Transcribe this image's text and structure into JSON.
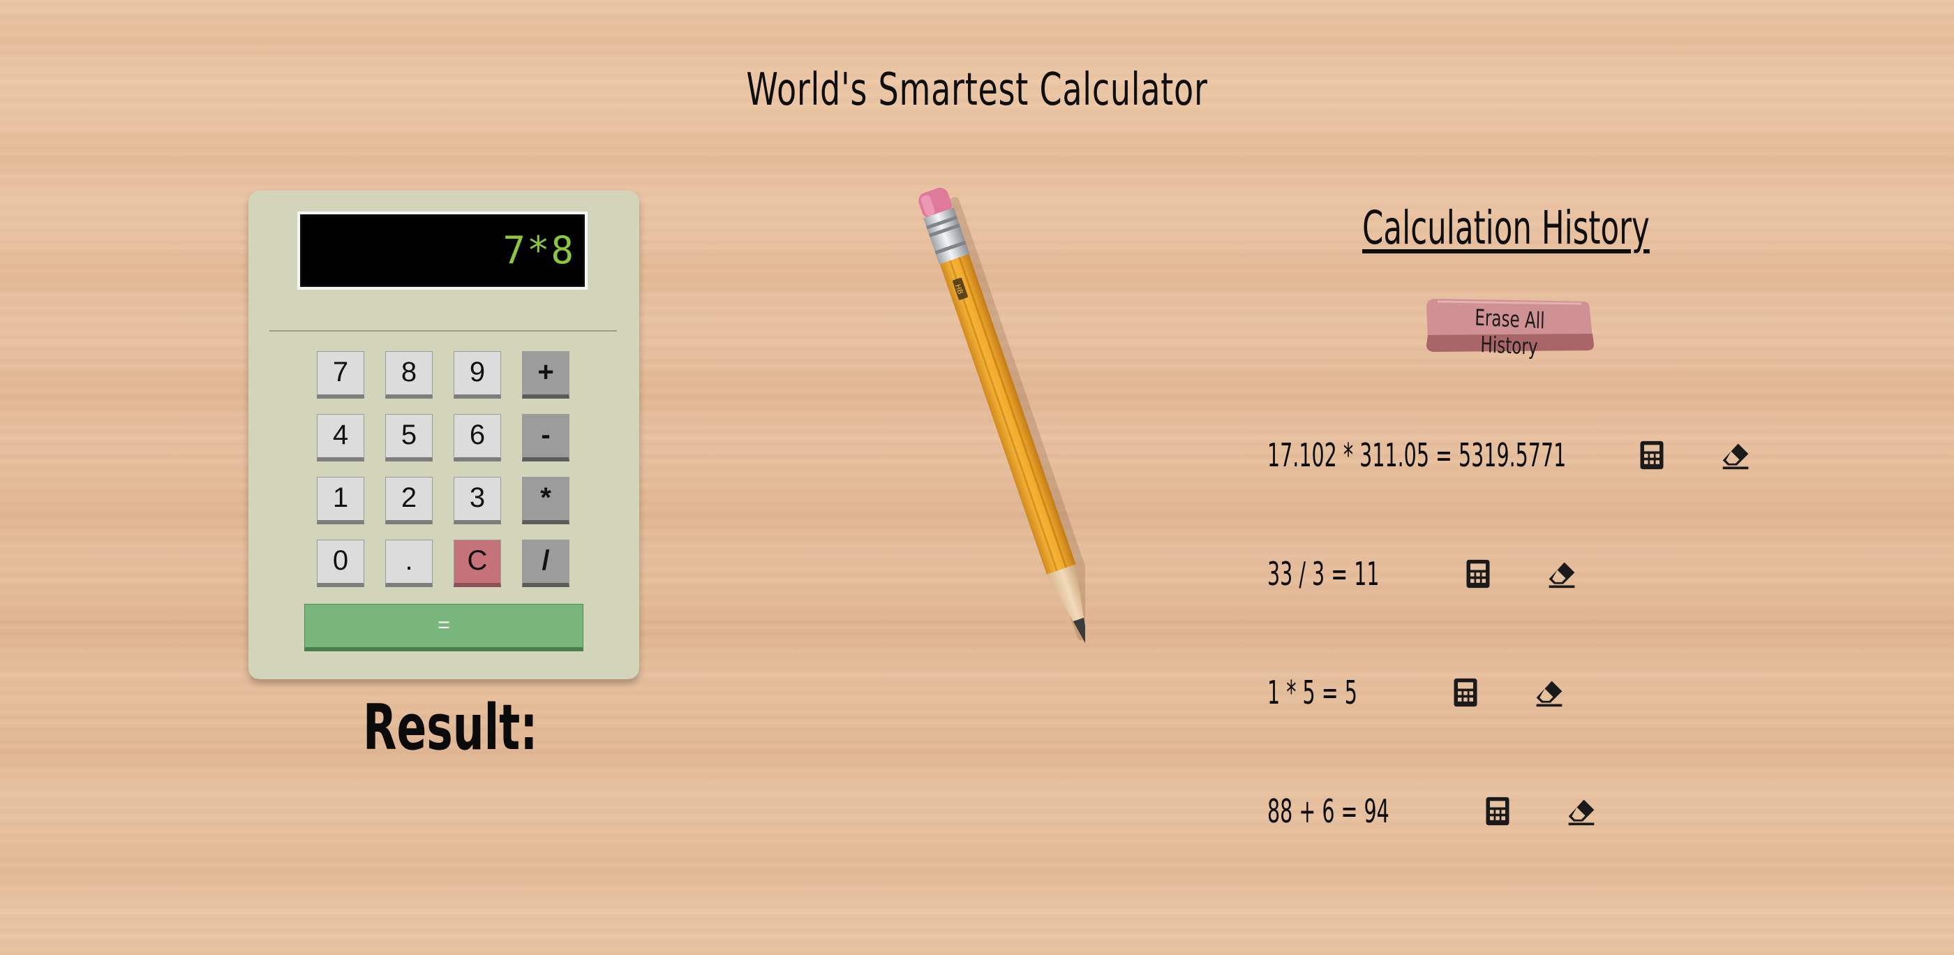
{
  "page": {
    "title": "World's Smartest Calculator"
  },
  "calculator": {
    "display_value": "7*8",
    "keys": {
      "k7": "7",
      "k8": "8",
      "k9": "9",
      "plus": "+",
      "k4": "4",
      "k5": "5",
      "k6": "6",
      "minus": "-",
      "k1": "1",
      "k2": "2",
      "k3": "3",
      "multiply": "*",
      "k0": "0",
      "dot": ".",
      "clear": "C",
      "divide": "/",
      "equals": "="
    },
    "result_label": "Result:"
  },
  "history": {
    "title": "Calculation History",
    "erase_all_label": "Erase All History",
    "items": [
      {
        "expression": "17.102 * 311.05 = 5319.5771"
      },
      {
        "expression": "33 / 3 = 11"
      },
      {
        "expression": "1 * 5 = 5"
      },
      {
        "expression": "88 + 6 = 94"
      }
    ],
    "row_icons": [
      "calculator-icon",
      "eraser-icon"
    ]
  },
  "colors": {
    "display_text": "#8cc63f",
    "equals_button": "#78b67c",
    "clear_button": "#c6727a",
    "operator_button": "#9c9c9c",
    "calculator_body": "#d3d5bb",
    "eraser": "#cf9194"
  }
}
